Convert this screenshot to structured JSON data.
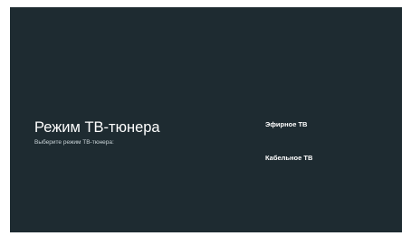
{
  "settings": {
    "title": "Режим ТВ-тюнера",
    "subtitle": "Выберите режим ТВ-тюнера:"
  },
  "options": [
    {
      "label": "Эфирное ТВ",
      "focused": true
    },
    {
      "label": "Кабельное ТВ",
      "focused": false
    }
  ],
  "colors": {
    "background": "#1e2b31",
    "text": "#ffffff",
    "subtext": "#c9d3d7"
  }
}
